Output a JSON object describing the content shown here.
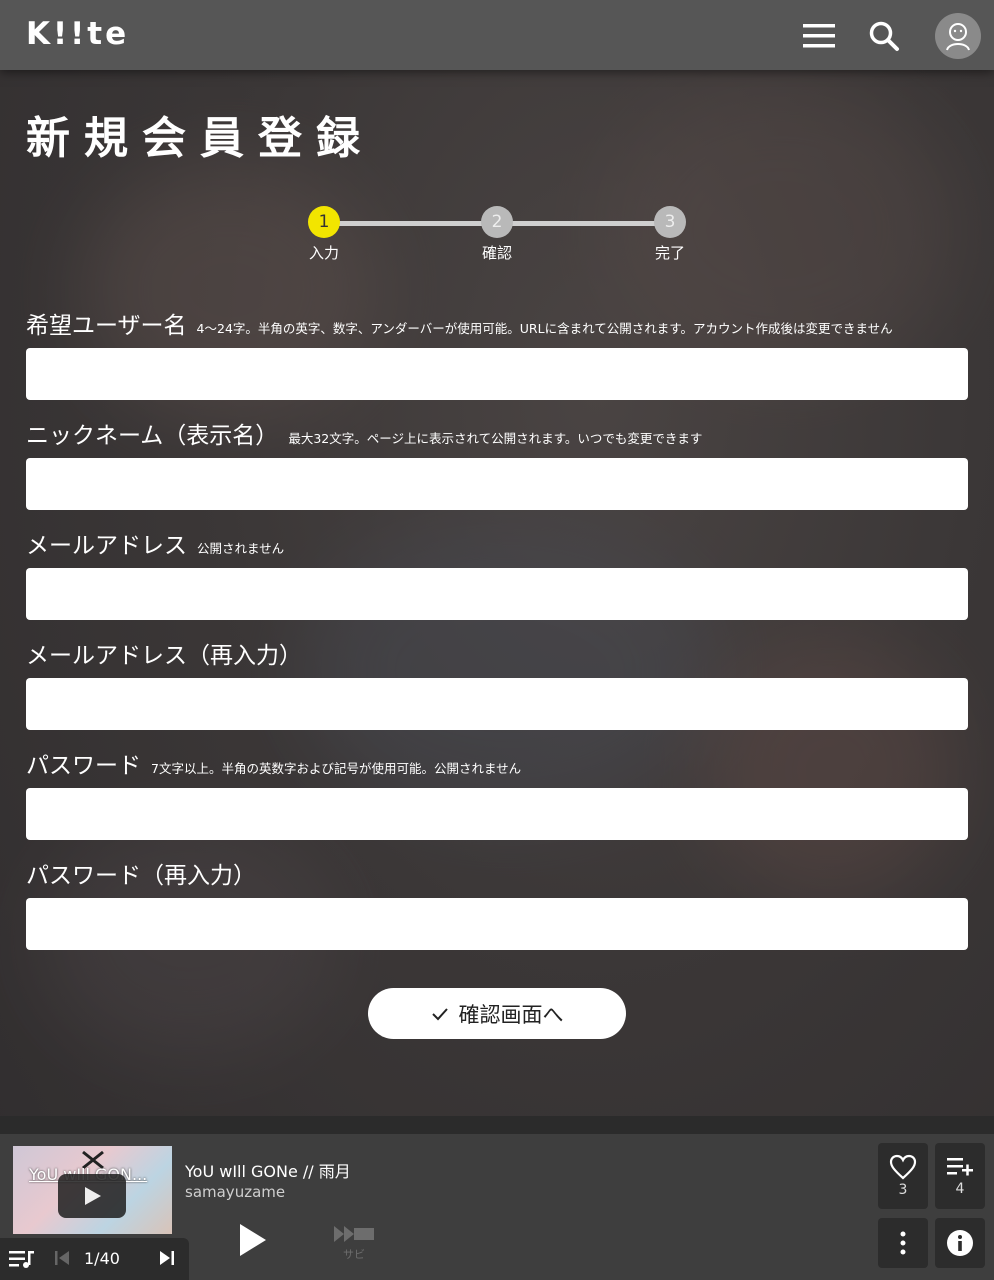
{
  "header": {
    "logo": "K!!te"
  },
  "page": {
    "title": "新規会員登録"
  },
  "stepper": {
    "steps": [
      {
        "number": "1",
        "label": "入力"
      },
      {
        "number": "2",
        "label": "確認"
      },
      {
        "number": "3",
        "label": "完了"
      }
    ],
    "active_step": 1
  },
  "form": {
    "username": {
      "label": "希望ユーザー名",
      "hint": "4〜24字。半角の英字、数字、アンダーバーが使用可能。URLに含まれて公開されます。アカウント作成後は変更できません",
      "value": ""
    },
    "nickname": {
      "label": "ニックネーム（表示名）",
      "hint": "最大32文字。ページ上に表示されて公開されます。いつでも変更できます",
      "value": ""
    },
    "email": {
      "label": "メールアドレス",
      "hint": "公開されません",
      "value": ""
    },
    "email_confirm": {
      "label": "メールアドレス（再入力）",
      "hint": "",
      "value": ""
    },
    "password": {
      "label": "パスワード",
      "hint": "7文字以上。半角の英数字および記号が使用可能。公開されません",
      "value": ""
    },
    "password_confirm": {
      "label": "パスワード（再入力）",
      "hint": "",
      "value": ""
    },
    "submit_label": "確認画面へ"
  },
  "player": {
    "thumbnail_title": "YoU wIll GON...",
    "track_title": "YoU wIll GONe // 雨月",
    "artist": "samayuzame",
    "queue_position": "1/40",
    "sabi_label": "サビ",
    "like_count": "3",
    "playlist_count": "4"
  },
  "colors": {
    "accent_step": "#f2e500",
    "header_bg": "#565656",
    "player_bg": "#3e3e3e"
  }
}
